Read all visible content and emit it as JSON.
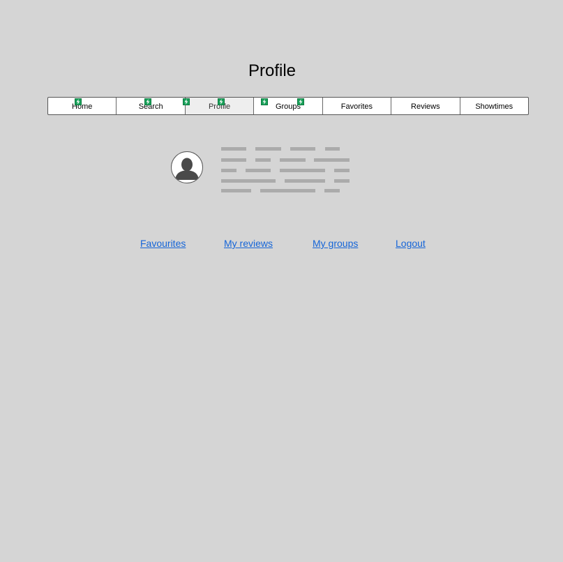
{
  "page": {
    "title": "Profile"
  },
  "nav": {
    "tabs": [
      {
        "label": "Home"
      },
      {
        "label": "Search"
      },
      {
        "label": "Profile",
        "active": true
      },
      {
        "label": "Groups"
      },
      {
        "label": "Favorites"
      },
      {
        "label": "Reviews"
      },
      {
        "label": "Showtimes"
      }
    ]
  },
  "profile": {
    "avatar_icon": "user-icon",
    "details_placeholder_icon": "text-placeholder-icon"
  },
  "links": {
    "favourites": "Favourites",
    "my_reviews": "My reviews",
    "my_groups": "My groups",
    "logout": "Logout"
  },
  "hotspot_icon": "lightning-bolt-icon",
  "colors": {
    "background": "#d5d5d5",
    "link": "#1565d8",
    "hotspot": "#1aa15a",
    "placeholder_line": "#ababab"
  }
}
